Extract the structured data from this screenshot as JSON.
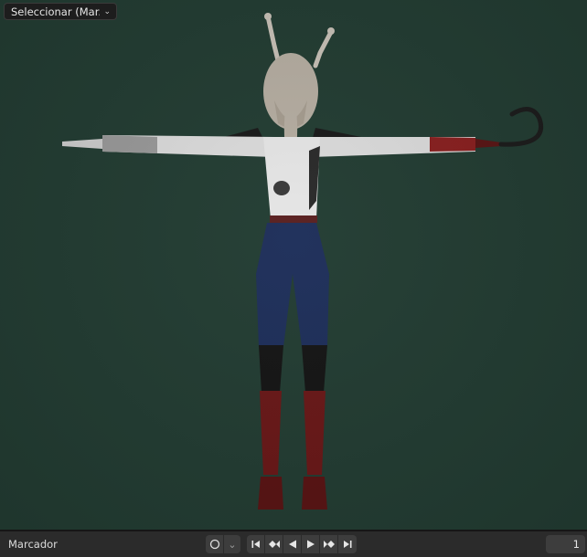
{
  "viewport": {
    "select_menu_label": "Seleccionar (Mar...",
    "background_color": "#233d33"
  },
  "timeline": {
    "marker_label": "Marcador",
    "current_frame": "1",
    "buttons": [
      "record-icon",
      "dropdown-icon",
      "jump-to-start-icon",
      "previous-keyframe-icon",
      "play-reverse-icon",
      "play-icon",
      "next-keyframe-icon",
      "jump-to-end-icon"
    ]
  }
}
